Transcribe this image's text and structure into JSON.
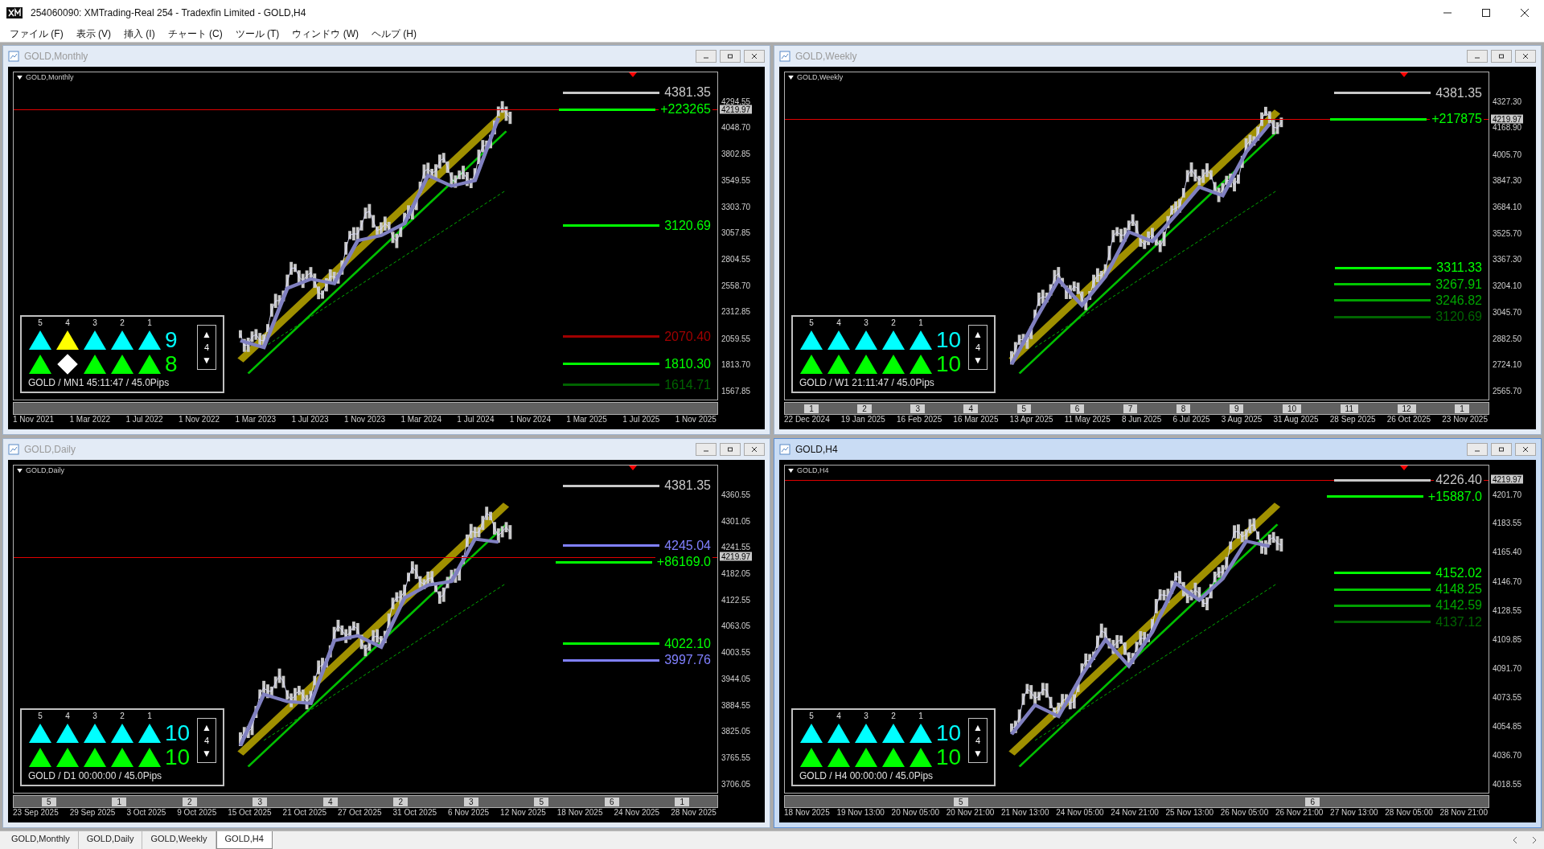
{
  "window": {
    "title": "254060090: XMTrading-Real 254 - Tradexfin Limited - GOLD,H4"
  },
  "menu": [
    "ファイル (F)",
    "表示 (V)",
    "挿入 (I)",
    "チャート (C)",
    "ツール (T)",
    "ウィンドウ (W)",
    "ヘルプ (H)"
  ],
  "charts": [
    {
      "title": "GOLD,Monthly",
      "active": false,
      "chart_label": "GOLD,Monthly",
      "current_price": "4219.97",
      "price_ticks": [
        "4294.55",
        "4048.70",
        "3802.85",
        "3549.55",
        "3303.70",
        "3057.85",
        "2804.55",
        "2558.70",
        "2312.85",
        "2059.55",
        "1813.70",
        "1567.85"
      ],
      "levels": [
        {
          "kind": "price",
          "text": "4381.35",
          "color": "#c8c8c8"
        },
        {
          "kind": "profit",
          "text": "+223265",
          "color": "#00ff00"
        },
        {
          "kind": "price",
          "text": "3120.69",
          "color": "#00ff00"
        },
        {
          "kind": "price",
          "text": "2070.40",
          "color": "#a00000"
        },
        {
          "kind": "price",
          "text": "1810.30",
          "color": "#00ff00"
        },
        {
          "kind": "price",
          "text": "1614.71",
          "color": "#006400"
        }
      ],
      "signal_panel": {
        "columns": [
          "5",
          "4",
          "3",
          "2",
          "1"
        ],
        "rows": [
          {
            "count": "9",
            "color": "#00ffff",
            "marks": [
              {
                "kind": "triangle",
                "color": "#00ffff"
              },
              {
                "kind": "triangle",
                "color": "#ffff00"
              },
              {
                "kind": "triangle",
                "color": "#00ffff"
              },
              {
                "kind": "triangle",
                "color": "#00ffff"
              },
              {
                "kind": "triangle",
                "color": "#00ffff"
              }
            ]
          },
          {
            "count": "8",
            "color": "#00ff00",
            "marks": [
              {
                "kind": "triangle",
                "color": "#00ff00"
              },
              {
                "kind": "diamond",
                "color": "#ffffff"
              },
              {
                "kind": "triangle",
                "color": "#00ff00"
              },
              {
                "kind": "triangle",
                "color": "#00ff00"
              },
              {
                "kind": "triangle",
                "color": "#00ff00"
              }
            ]
          }
        ],
        "stepper": {
          "up": "▲",
          "value": "4",
          "down": "▼"
        },
        "footer": "GOLD / MN1 45:11:47 / 45.0Pips"
      },
      "time_labels": [
        "1 Nov 2021",
        "1 Mar 2022",
        "1 Jul 2022",
        "1 Nov 2022",
        "1 Mar 2023",
        "1 Jul 2023",
        "1 Nov 2023",
        "1 Mar 2024",
        "1 Jul 2024",
        "1 Nov 2024",
        "1 Mar 2025",
        "1 Jul 2025",
        "1 Nov 2025"
      ]
    },
    {
      "title": "GOLD,Weekly",
      "active": false,
      "chart_label": "GOLD,Weekly",
      "current_price": "4219.97",
      "price_ticks": [
        "4327.30",
        "4168.90",
        "4005.70",
        "3847.30",
        "3684.10",
        "3525.70",
        "3367.30",
        "3204.10",
        "3045.70",
        "2882.50",
        "2724.10",
        "2565.70"
      ],
      "levels": [
        {
          "kind": "price",
          "text": "4381.35",
          "color": "#c8c8c8"
        },
        {
          "kind": "profit",
          "text": "+217875",
          "color": "#00ff00"
        },
        {
          "kind": "price",
          "text": "3311.33",
          "color": "#00ff00"
        },
        {
          "kind": "price",
          "text": "3267.91",
          "color": "#00c800"
        },
        {
          "kind": "price",
          "text": "3246.82",
          "color": "#00a000"
        },
        {
          "kind": "price",
          "text": "3120.69",
          "color": "#006400"
        }
      ],
      "signal_panel": {
        "columns": [
          "5",
          "4",
          "3",
          "2",
          "1"
        ],
        "rows": [
          {
            "count": "10",
            "color": "#00ffff",
            "marks": [
              {
                "kind": "triangle",
                "color": "#00ffff"
              },
              {
                "kind": "triangle",
                "color": "#00ffff"
              },
              {
                "kind": "triangle",
                "color": "#00ffff"
              },
              {
                "kind": "triangle",
                "color": "#00ffff"
              },
              {
                "kind": "triangle",
                "color": "#00ffff"
              }
            ]
          },
          {
            "count": "10",
            "color": "#00ff00",
            "marks": [
              {
                "kind": "triangle",
                "color": "#00ff00"
              },
              {
                "kind": "triangle",
                "color": "#00ff00"
              },
              {
                "kind": "triangle",
                "color": "#00ff00"
              },
              {
                "kind": "triangle",
                "color": "#00ff00"
              },
              {
                "kind": "triangle",
                "color": "#00ff00"
              }
            ]
          }
        ],
        "stepper": {
          "up": "▲",
          "value": "4",
          "down": "▼"
        },
        "footer": "GOLD / W1 21:11:47 / 45.0Pips"
      },
      "period_strip": [
        "1",
        "2",
        "3",
        "4",
        "5",
        "6",
        "7",
        "8",
        "9",
        "10",
        "11",
        "12",
        "1"
      ],
      "time_labels": [
        "22 Dec 2024",
        "19 Jan 2025",
        "16 Feb 2025",
        "16 Mar 2025",
        "13 Apr 2025",
        "11 May 2025",
        "8 Jun 2025",
        "6 Jul 2025",
        "3 Aug 2025",
        "31 Aug 2025",
        "28 Sep 2025",
        "26 Oct 2025",
        "23 Nov 2025"
      ]
    },
    {
      "title": "GOLD,Daily",
      "active": false,
      "chart_label": "GOLD,Daily",
      "current_price": "4219.97",
      "price_ticks": [
        "4360.55",
        "4301.05",
        "4241.55",
        "4182.05",
        "4122.55",
        "4063.05",
        "4003.55",
        "3944.05",
        "3884.55",
        "3825.05",
        "3765.55",
        "3706.05"
      ],
      "levels": [
        {
          "kind": "price",
          "text": "4381.35",
          "color": "#c8c8c8"
        },
        {
          "kind": "price",
          "text": "4245.04",
          "color": "#8080ff"
        },
        {
          "kind": "profit",
          "text": "+86169.0",
          "color": "#00ff00"
        },
        {
          "kind": "price",
          "text": "4022.10",
          "color": "#00ff00"
        },
        {
          "kind": "price",
          "text": "3997.76",
          "color": "#8080ff"
        }
      ],
      "signal_panel": {
        "columns": [
          "5",
          "4",
          "3",
          "2",
          "1"
        ],
        "rows": [
          {
            "count": "10",
            "color": "#00ffff",
            "marks": [
              {
                "kind": "triangle",
                "color": "#00ffff"
              },
              {
                "kind": "triangle",
                "color": "#00ffff"
              },
              {
                "kind": "triangle",
                "color": "#00ffff"
              },
              {
                "kind": "triangle",
                "color": "#00ffff"
              },
              {
                "kind": "triangle",
                "color": "#00ffff"
              }
            ]
          },
          {
            "count": "10",
            "color": "#00ff00",
            "marks": [
              {
                "kind": "triangle",
                "color": "#00ff00"
              },
              {
                "kind": "triangle",
                "color": "#00ff00"
              },
              {
                "kind": "triangle",
                "color": "#00ff00"
              },
              {
                "kind": "triangle",
                "color": "#00ff00"
              },
              {
                "kind": "triangle",
                "color": "#00ff00"
              }
            ]
          }
        ],
        "stepper": {
          "up": "▲",
          "value": "4",
          "down": "▼"
        },
        "footer": "GOLD / D1 00:00:00 / 45.0Pips"
      },
      "period_strip": [
        "5",
        "1",
        "2",
        "3",
        "4",
        "2",
        "3",
        "5",
        "6",
        "1"
      ],
      "time_labels": [
        "23 Sep 2025",
        "29 Sep 2025",
        "3 Oct 2025",
        "9 Oct 2025",
        "15 Oct 2025",
        "21 Oct 2025",
        "27 Oct 2025",
        "31 Oct 2025",
        "6 Nov 2025",
        "12 Nov 2025",
        "18 Nov 2025",
        "24 Nov 2025",
        "28 Nov 2025"
      ]
    },
    {
      "title": "GOLD,H4",
      "active": true,
      "chart_label": "GOLD,H4",
      "current_price": "4219.97",
      "price_ticks": [
        "4201.70",
        "4183.55",
        "4165.40",
        "4146.70",
        "4128.55",
        "4109.85",
        "4091.70",
        "4073.55",
        "4054.85",
        "4036.70",
        "4018.55"
      ],
      "levels": [
        {
          "kind": "price",
          "text": "4226.40",
          "color": "#c8c8c8"
        },
        {
          "kind": "profit",
          "text": "+15887.0",
          "color": "#00ff00"
        },
        {
          "kind": "price",
          "text": "4152.02",
          "color": "#00ff00"
        },
        {
          "kind": "price",
          "text": "4148.25",
          "color": "#00c800"
        },
        {
          "kind": "price",
          "text": "4142.59",
          "color": "#00a000"
        },
        {
          "kind": "price",
          "text": "4137.12",
          "color": "#006400"
        }
      ],
      "signal_panel": {
        "columns": [
          "5",
          "4",
          "3",
          "2",
          "1"
        ],
        "rows": [
          {
            "count": "10",
            "color": "#00ffff",
            "marks": [
              {
                "kind": "triangle",
                "color": "#00ffff"
              },
              {
                "kind": "triangle",
                "color": "#00ffff"
              },
              {
                "kind": "triangle",
                "color": "#00ffff"
              },
              {
                "kind": "triangle",
                "color": "#00ffff"
              },
              {
                "kind": "triangle",
                "color": "#00ffff"
              }
            ]
          },
          {
            "count": "10",
            "color": "#00ff00",
            "marks": [
              {
                "kind": "triangle",
                "color": "#00ff00"
              },
              {
                "kind": "triangle",
                "color": "#00ff00"
              },
              {
                "kind": "triangle",
                "color": "#00ff00"
              },
              {
                "kind": "triangle",
                "color": "#00ff00"
              },
              {
                "kind": "triangle",
                "color": "#00ff00"
              }
            ]
          }
        ],
        "stepper": {
          "up": "▲",
          "value": "4",
          "down": "▼"
        },
        "footer": "GOLD / H4 00:00:00 / 45.0Pips"
      },
      "period_strip": [
        "5",
        "6"
      ],
      "time_labels": [
        "18 Nov 2025",
        "19 Nov 13:00",
        "20 Nov 05:00",
        "20 Nov 21:00",
        "21 Nov 13:00",
        "24 Nov 05:00",
        "24 Nov 21:00",
        "25 Nov 13:00",
        "26 Nov 05:00",
        "26 Nov 21:00",
        "27 Nov 13:00",
        "28 Nov 05:00",
        "28 Nov 21:00"
      ]
    }
  ],
  "tabs": [
    {
      "label": "GOLD,Monthly",
      "selected": false
    },
    {
      "label": "GOLD,Daily",
      "selected": false
    },
    {
      "label": "GOLD,Weekly",
      "selected": false
    },
    {
      "label": "GOLD,H4",
      "selected": true
    }
  ]
}
